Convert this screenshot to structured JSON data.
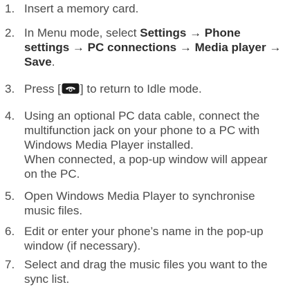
{
  "steps": [
    {
      "number": "1.",
      "text": "Insert a memory card."
    },
    {
      "number": "2.",
      "prefix": "In Menu mode, select ",
      "path": [
        "Settings",
        "Phone settings",
        "PC connections",
        "Media player",
        "Save"
      ],
      "arrow": "→",
      "suffix": "."
    },
    {
      "number": "3.",
      "before_icon": "Press [",
      "icon": "end-call-key-icon",
      "after_icon": "] to return to Idle mode."
    },
    {
      "number": "4.",
      "line1": "Using an optional PC data cable, connect the",
      "line2": "multifunction jack on your phone to a PC with",
      "line3": "Windows Media Player installed.",
      "note_line1": "When connected, a pop-up window will appear",
      "note_line2": "on the PC."
    },
    {
      "number": "5.",
      "line1": "Open Windows Media Player to synchronise",
      "line2": "music files."
    },
    {
      "number": "6.",
      "line1": "Edit or enter your phone’s name in the pop-up",
      "line2": "window (if necessary)."
    },
    {
      "number": "7.",
      "line1": "Select and drag the music files you want to the",
      "line2": "sync list."
    }
  ]
}
